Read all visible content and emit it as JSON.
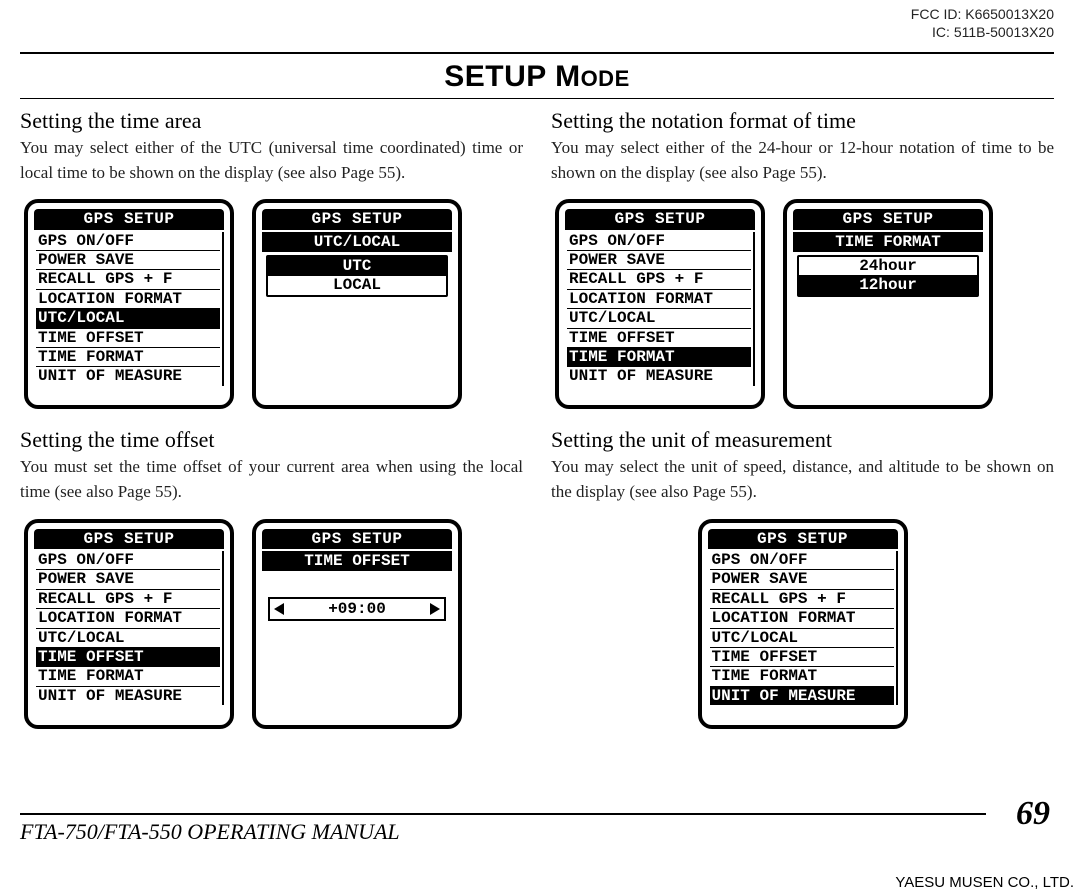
{
  "header": {
    "fcc_id": "FCC ID: K6650013X20",
    "ic": "IC: 511B-50013X20"
  },
  "title_main": "SETUP M",
  "title_suffix": "ODE",
  "left": {
    "sec1": {
      "heading": "Setting the time area",
      "body": "You may select either of the UTC (universal time coordinated) time or local time to be shown on the display (see also Page 55).",
      "screen_list": {
        "title": "GPS SETUP",
        "items": [
          "GPS ON/OFF",
          "POWER SAVE",
          "RECALL GPS + F",
          "LOCATION FORMAT",
          "UTC/LOCAL",
          "TIME OFFSET",
          "TIME FORMAT",
          "UNIT OF MEASURE"
        ],
        "selected_index": 4
      },
      "screen_detail": {
        "title": "GPS SETUP",
        "subtitle": "UTC/LOCAL",
        "options": [
          "UTC",
          "LOCAL"
        ],
        "selected_index": 0
      }
    },
    "sec2": {
      "heading": "Setting the time offset",
      "body": "You must set the time offset of your current area when using the local time (see also Page 55).",
      "screen_list": {
        "title": "GPS SETUP",
        "items": [
          "GPS ON/OFF",
          "POWER SAVE",
          "RECALL GPS + F",
          "LOCATION FORMAT",
          "UTC/LOCAL",
          "TIME OFFSET",
          "TIME FORMAT",
          "UNIT OF MEASURE"
        ],
        "selected_index": 5
      },
      "screen_detail": {
        "title": "GPS SETUP",
        "subtitle": "TIME OFFSET",
        "value": "+09:00"
      }
    }
  },
  "right": {
    "sec1": {
      "heading": "Setting the notation format of time",
      "body": "You may select either of the 24-hour or 12-hour notation of time to be shown on the display (see also Page 55).",
      "screen_list": {
        "title": "GPS SETUP",
        "items": [
          "GPS ON/OFF",
          "POWER SAVE",
          "RECALL GPS + F",
          "LOCATION FORMAT",
          "UTC/LOCAL",
          "TIME OFFSET",
          "TIME FORMAT",
          "UNIT OF MEASURE"
        ],
        "selected_index": 6
      },
      "screen_detail": {
        "title": "GPS SETUP",
        "subtitle": "TIME FORMAT",
        "options": [
          "24hour",
          "12hour"
        ],
        "selected_index": 1
      }
    },
    "sec2": {
      "heading": "Setting the unit of measurement",
      "body": "You may select the unit of speed, distance, and altitude to be shown on the display (see also Page 55).",
      "screen_list": {
        "title": "GPS SETUP",
        "items": [
          "GPS ON/OFF",
          "POWER SAVE",
          "RECALL GPS + F",
          "LOCATION FORMAT",
          "UTC/LOCAL",
          "TIME OFFSET",
          "TIME FORMAT",
          "UNIT OF MEASURE"
        ],
        "selected_index": 7
      }
    }
  },
  "footer": {
    "page_number": "69",
    "manual": "FTA-750/FTA-550 OPERATING MANUAL",
    "company": "YAESU MUSEN CO., LTD."
  }
}
